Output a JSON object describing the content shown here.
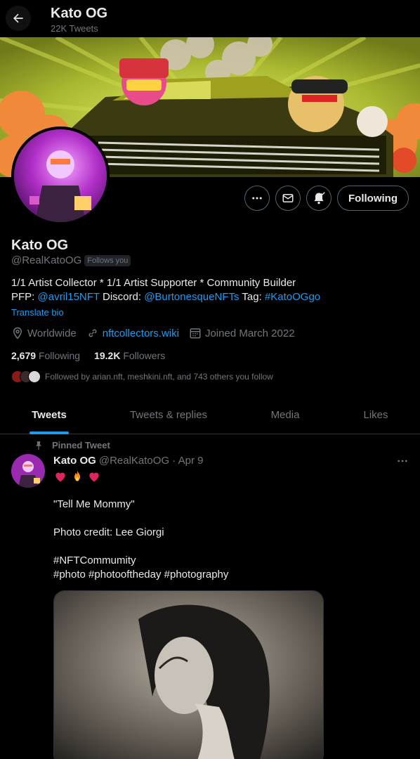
{
  "header": {
    "title": "Kato OG",
    "tweet_count": "22K Tweets"
  },
  "profile": {
    "name": "Kato OG",
    "handle": "@RealKatoOG",
    "follows_you": "Follows you",
    "bio_line1": "1/1 Artist Collector * 1/1 Artist Supporter * Community Builder",
    "bio_pfp_label": "PFP: ",
    "bio_pfp_link": "@avril15NFT",
    "bio_discord_label": " Discord: ",
    "bio_discord_link": "@BurtonesqueNFTs",
    "bio_tag_label": " Tag: ",
    "bio_tag_link": "#KatoOGgo",
    "translate": "Translate bio",
    "location": "Worldwide",
    "website": "nftcollectors.wiki",
    "joined": "Joined March 2022",
    "following_count": "2,679",
    "following_label": "Following",
    "followers_count": "19.2K",
    "followers_label": "Followers",
    "followed_by": "Followed by arian.nft, meshkini.nft, and 743 others you follow",
    "following_button": "Following"
  },
  "tabs": [
    {
      "label": "Tweets",
      "active": true
    },
    {
      "label": "Tweets & replies",
      "active": false
    },
    {
      "label": "Media",
      "active": false
    },
    {
      "label": "Likes",
      "active": false
    }
  ],
  "tweet": {
    "pinned_label": "Pinned Tweet",
    "author": "Kato OG",
    "meta": "@RealKatoOG · Apr 9",
    "line1": "\"Tell Me Mommy\"",
    "line2": "Photo credit: Lee Giorgi",
    "hashtags1": "#NFTCommumity",
    "hashtags2": "#photo #photooftheday #photography"
  },
  "colors": {
    "accent": "#1d9bf0",
    "muted": "#71767b",
    "text": "#e7e9ea",
    "background": "#000000"
  }
}
